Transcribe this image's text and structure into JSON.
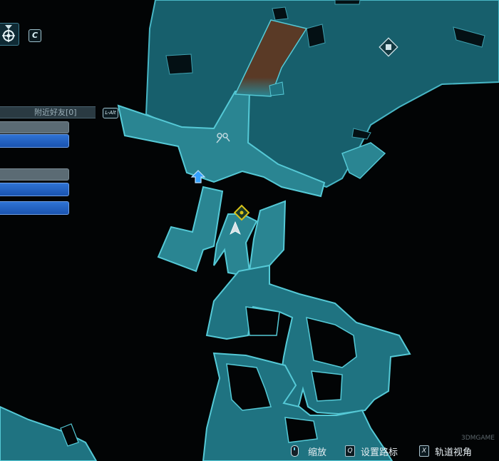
{
  "sidebar": {
    "friends_label": "附近好友[0]",
    "open_key": "C",
    "friends_key": "L-Alt"
  },
  "hints": {
    "zoom_label": "缩放",
    "waypoint_key": "Q",
    "waypoint_label": "设置路标",
    "orbit_key": "X",
    "orbit_label": "轨道视角"
  },
  "watermark": "3DMGAME",
  "colors": {
    "map_fill": "#1e6e7c",
    "map_edge": "#4fc3d2",
    "corridor_fill": "#2a8592",
    "highlight": "#5a3a26",
    "marker_blue": "#34a0ff",
    "marker_yellow": "#d7c31a",
    "background": "#020405"
  },
  "icons": {
    "top_icon": "medal-gear-icon",
    "fast_travel": "fast-travel-arrow-icon",
    "quest": "quest-diamond-icon",
    "player": "player-arrow-icon",
    "vendor": "vending-machine-icon",
    "keys": "keys-icon"
  }
}
